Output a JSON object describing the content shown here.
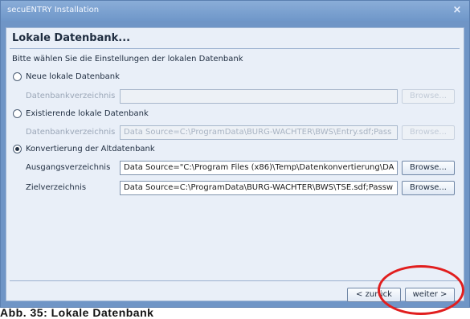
{
  "window": {
    "title": "secuENTRY Installation",
    "close_icon": "×"
  },
  "page": {
    "heading": "Lokale Datenbank...",
    "instruction": "Bitte wählen Sie die Einstellungen der lokalen Datenbank"
  },
  "options": [
    {
      "label": "Neue lokale Datenbank",
      "selected": false,
      "field_label": "Datenbankverzeichnis",
      "field_value": "",
      "button": "Browse..."
    },
    {
      "label": "Existierende lokale Datenbank",
      "selected": false,
      "field_label": "Datenbankverzeichnis",
      "field_value": "Data Source=C:\\ProgramData\\BURG-WACHTER\\BWS\\Entry.sdf;Pass",
      "button": "Browse..."
    },
    {
      "label": "Konvertierung der Altdatenbank",
      "selected": true,
      "source_label": "Ausgangsverzeichnis",
      "source_value": "Data Source=\"C:\\Program Files (x86)\\Temp\\Datenkonvertierung\\DA",
      "source_button": "Browse...",
      "target_label": "Zielverzeichnis",
      "target_value": "Data Source=C:\\ProgramData\\BURG-WACHTER\\BWS\\TSE.sdf;Passw",
      "target_button": "Browse..."
    }
  ],
  "footer": {
    "back_button": "< zurück",
    "next_button": "weiter >"
  },
  "caption": "Abb. 35: Lokale Datenbank",
  "colors": {
    "title_bar": "#7a9fd0",
    "content_bg": "#e9eff8",
    "annotation": "#e11e1e"
  }
}
